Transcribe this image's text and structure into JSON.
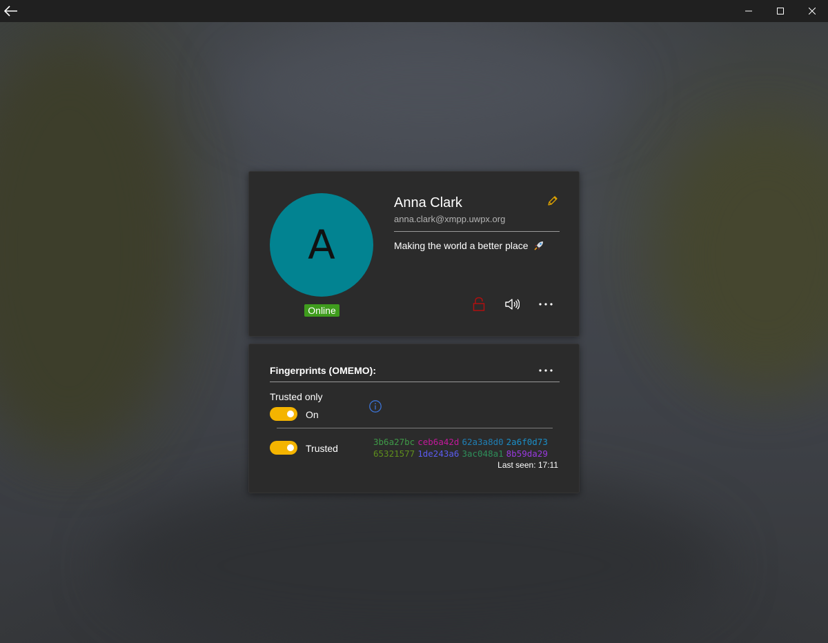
{
  "window": {
    "back_icon": "back-arrow-icon",
    "minimize_icon": "minimize-icon",
    "maximize_icon": "maximize-icon",
    "close_icon": "close-icon"
  },
  "profile": {
    "avatar_letter": "A",
    "avatar_color": "#028391",
    "presence": "Online",
    "presence_color": "#3f9c1d",
    "name": "Anna Clark",
    "jid": "anna.clark@xmpp.uwpx.org",
    "status_message": "Making the world a better place",
    "status_emoji_icon": "rocket-icon",
    "actions": {
      "edit_icon": "pencil-icon",
      "lock_icon": "lock-icon",
      "sound_icon": "speaker-icon",
      "more_icon": "more-icon"
    }
  },
  "omemo": {
    "title": "Fingerprints (OMEMO):",
    "trusted_only_label": "Trusted only",
    "trusted_only_state": "On",
    "info_icon": "info-icon",
    "devices": [
      {
        "trust_label": "Trusted",
        "fingerprint_line1": [
          "3b6a27bc",
          "ceb6a42d",
          "62a3a8d0",
          "2a6f0d73"
        ],
        "fingerprint_line2": [
          "65321577",
          "1de243a6",
          "3ac048a1",
          "8b59da29"
        ],
        "colors_line1": [
          "#3f9a48",
          "#c2189a",
          "#1f7fb5",
          "#1a8fc8"
        ],
        "colors_line2": [
          "#5f8f1c",
          "#5b5cf0",
          "#2e8f5a",
          "#9a3ae0"
        ],
        "last_seen": "Last seen: 17:11"
      }
    ]
  }
}
